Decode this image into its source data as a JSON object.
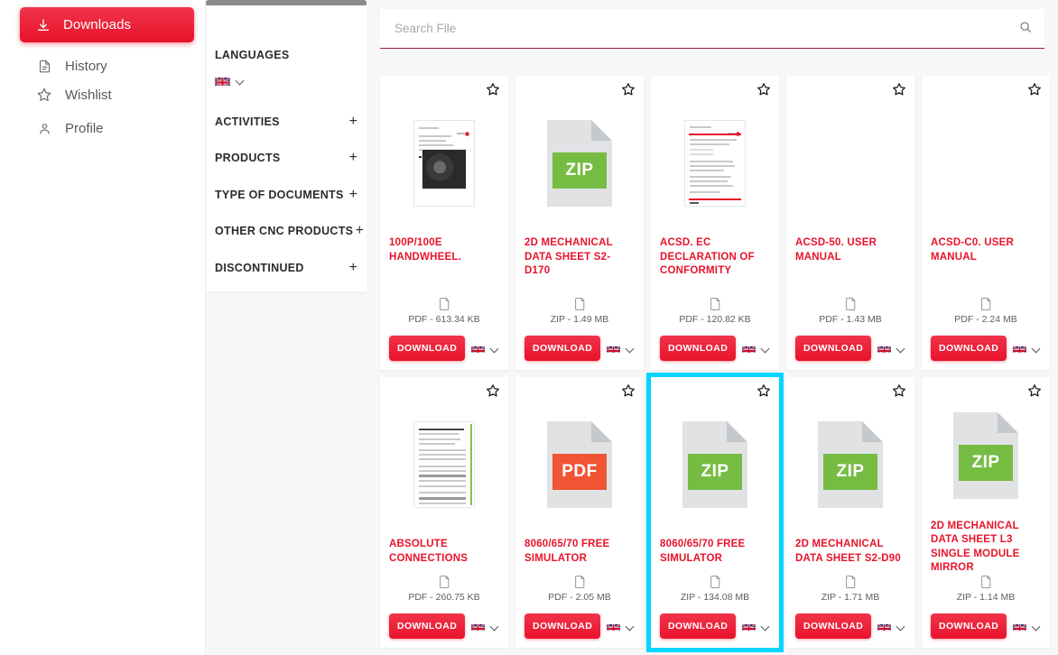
{
  "colors": {
    "brand_red": "#e8132b",
    "highlight_cyan": "#00d5ff",
    "zip_green": "#76bc43",
    "pdf_orange": "#f05434",
    "page_bg": "#f7f7f7"
  },
  "left_nav": {
    "items": [
      {
        "label": "Downloads",
        "icon": "download-icon",
        "active": true
      },
      {
        "label": "History",
        "icon": "document-icon",
        "active": false
      },
      {
        "label": "Wishlist",
        "icon": "star-icon",
        "active": false
      },
      {
        "label": "Profile",
        "icon": "person-icon",
        "active": false
      }
    ]
  },
  "filter_panel": {
    "languages_title": "LANGUAGES",
    "language_selected_flag": "uk-flag-icon",
    "groups": [
      {
        "label": "ACTIVITIES",
        "toggle": "+"
      },
      {
        "label": "PRODUCTS",
        "toggle": "+"
      },
      {
        "label": "TYPE OF DOCUMENTS",
        "toggle": "+"
      },
      {
        "label": "OTHER CNC PRODUCTS",
        "toggle": "+"
      },
      {
        "label": "DISCONTINUED",
        "toggle": "+"
      }
    ]
  },
  "search": {
    "placeholder": "Search File",
    "value": "",
    "icon": "search-icon"
  },
  "cards": [
    {
      "title": "100P/100E HANDWHEEL.",
      "filesize": "PDF - 613.34 KB",
      "thumb": "document-preview",
      "download_label": "DOWNLOAD",
      "lang_flag": "uk-flag-icon",
      "highlighted": false
    },
    {
      "title": "2D MECHANICAL DATA SHEET S2-D170",
      "filesize": "ZIP - 1.49 MB",
      "thumb": "zip",
      "download_label": "DOWNLOAD",
      "lang_flag": "uk-flag-icon",
      "highlighted": false
    },
    {
      "title": "ACSD. EC DECLARATION OF CONFORMITY",
      "filesize": "PDF - 120.82 KB",
      "thumb": "document-preview",
      "download_label": "DOWNLOAD",
      "lang_flag": "uk-flag-icon",
      "highlighted": false
    },
    {
      "title": "ACSD-50. USER MANUAL",
      "filesize": "PDF - 1.43 MB",
      "thumb": "none",
      "download_label": "DOWNLOAD",
      "lang_flag": "uk-flag-icon",
      "highlighted": false
    },
    {
      "title": "ACSD-C0. USER MANUAL",
      "filesize": "PDF - 2.24 MB",
      "thumb": "none",
      "download_label": "DOWNLOAD",
      "lang_flag": "uk-flag-icon",
      "highlighted": false
    },
    {
      "title": "ABSOLUTE CONNECTIONS",
      "filesize": "PDF - 260.75 KB",
      "thumb": "document-preview",
      "download_label": "DOWNLOAD",
      "lang_flag": "uk-flag-icon",
      "highlighted": false
    },
    {
      "title": "8060/65/70 FREE SIMULATOR",
      "filesize": "PDF - 2.05 MB",
      "thumb": "pdf",
      "download_label": "DOWNLOAD",
      "lang_flag": "uk-flag-icon",
      "highlighted": false
    },
    {
      "title": "8060/65/70 FREE SIMULATOR",
      "filesize": "ZIP - 134.08 MB",
      "thumb": "zip",
      "download_label": "DOWNLOAD",
      "lang_flag": "uk-flag-icon",
      "highlighted": true
    },
    {
      "title": "2D MECHANICAL DATA SHEET S2-D90",
      "filesize": "ZIP - 1.71 MB",
      "thumb": "zip",
      "download_label": "DOWNLOAD",
      "lang_flag": "uk-flag-icon",
      "highlighted": false
    },
    {
      "title": "2D MECHANICAL DATA SHEET L3 SINGLE MODULE MIRROR",
      "filesize": "ZIP - 1.14 MB",
      "thumb": "zip",
      "download_label": "DOWNLOAD",
      "lang_flag": "uk-flag-icon",
      "highlighted": false
    }
  ]
}
